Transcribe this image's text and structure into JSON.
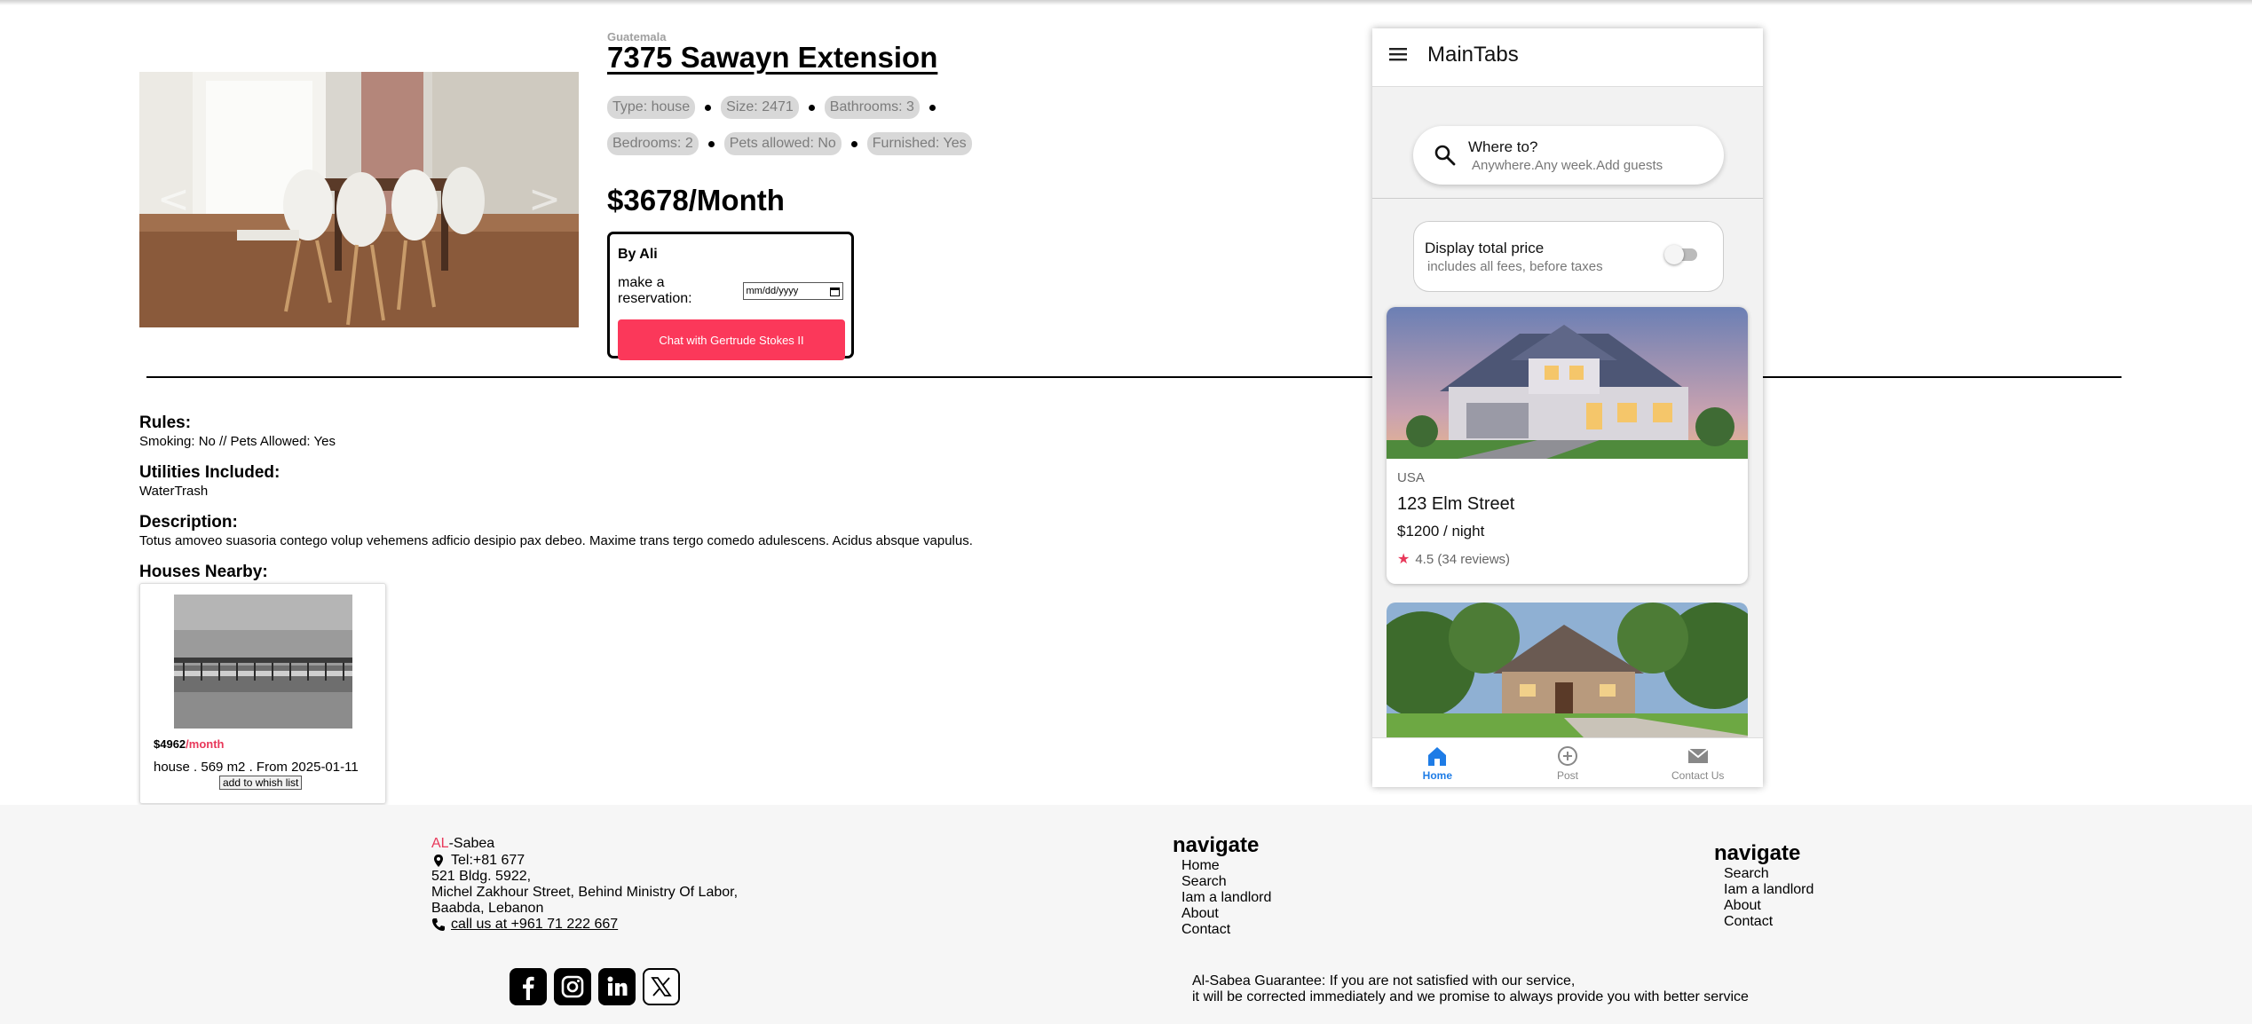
{
  "listing": {
    "country": "Guatemala",
    "title": "7375 Sawayn Extension",
    "tags_row1": [
      "Type: house",
      "Size: 2471",
      "Bathrooms: 3"
    ],
    "tags_row2": [
      "Bedrooms: 2",
      "Pets allowed: No",
      "Furnished: Yes"
    ],
    "price": "$3678/Month",
    "carousel": {
      "prev": "<",
      "next": ">"
    }
  },
  "reservation": {
    "by": "By Ali",
    "label": "make a reservation:",
    "date_placeholder": "mm/dd/yyyy",
    "chat_button": "Chat with Gertrude Stokes II"
  },
  "details": {
    "rules_h": "Rules:",
    "rules_t": "Smoking: No // Pets Allowed: Yes",
    "utilities_h": "Utilities Included:",
    "utilities_t": "WaterTrash",
    "description_h": "Description:",
    "description_t": "Totus amoveo suasoria contego volup vehemens adficio desipio pax debeo. Maxime trans tergo comedo adulescens. Acidus absque vapulus.",
    "nearby_h": "Houses Nearby:"
  },
  "nearby": {
    "price": "$4962",
    "unit": "/month",
    "info": "house . 569 m2 . From 2025-01-11",
    "wish_button": "add to whish list"
  },
  "phone": {
    "header_title": "MainTabs",
    "search_main": "Where to?",
    "search_sub": "Anywhere.Any week.Add guests",
    "toggle_title": "Display total price",
    "toggle_sub": "includes all fees, before taxes",
    "toggle_on": false,
    "card": {
      "country": "USA",
      "title": "123 Elm Street",
      "price": "$1200 / night",
      "rating": "4.5 (34 reviews)"
    },
    "tabs": [
      {
        "label": "Home",
        "active": true
      },
      {
        "label": "Post",
        "active": false
      },
      {
        "label": "Contact Us",
        "active": false
      }
    ]
  },
  "footer": {
    "brand_al": "AL",
    "brand_rest": "-Sabea",
    "tel": "Tel:+81 677",
    "addr1": "521 Bldg. 5922,",
    "addr2": "Michel Zakhour Street, Behind Ministry Of Labor,",
    "addr3": "Baabda, Lebanon",
    "call": "call us at +961 71 222 667",
    "nav1_title": "navigate",
    "nav1_items": [
      "Home",
      "Search",
      "Iam a landlord",
      "About",
      "Contact"
    ],
    "nav2_title": "navigate",
    "nav2_items": [
      "Search",
      "Iam a landlord",
      "About",
      "Contact"
    ],
    "guarantee1": "Al-Sabea Guarantee: If you are not satisfied with our service,",
    "guarantee2": "it will be corrected immediately and we promise to always provide you with better service",
    "social": [
      "facebook-icon",
      "instagram-icon",
      "linkedin-icon",
      "x-icon"
    ]
  },
  "colors": {
    "accent": "#fb385a",
    "tab_active": "#1e7ce6",
    "footer_bg": "#f6f6f6"
  }
}
